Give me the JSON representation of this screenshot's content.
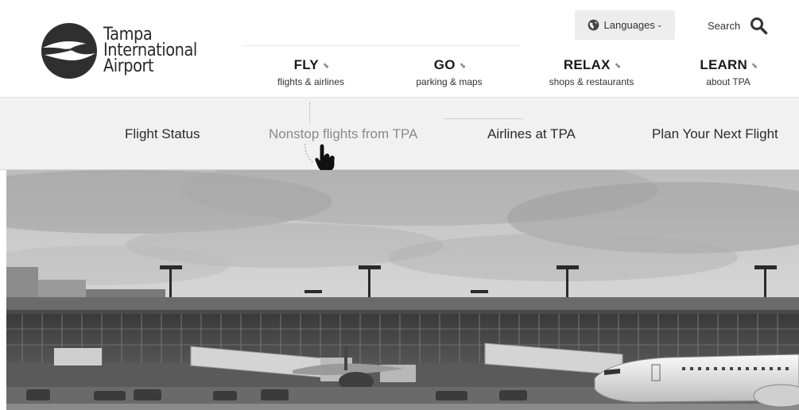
{
  "brand": {
    "logo_lines": [
      "Tampa",
      "International",
      "Airport"
    ]
  },
  "header": {
    "languages_label": "Languages",
    "search_label": "Search"
  },
  "nav": [
    {
      "label": "FLY",
      "sub": "flights & airlines"
    },
    {
      "label": "GO",
      "sub": "parking & maps"
    },
    {
      "label": "RELAX",
      "sub": "shops & restaurants"
    },
    {
      "label": "LEARN",
      "sub": "about TPA"
    }
  ],
  "subnav": [
    {
      "label": "Flight Status",
      "state": "normal"
    },
    {
      "label": "Nonstop flights from TPA",
      "state": "hovered"
    },
    {
      "label": "Airlines at TPA",
      "state": "normal"
    },
    {
      "label": "Plan Your Next Flight",
      "state": "normal"
    }
  ],
  "icons": {
    "languages": "globe-icon",
    "languages_caret": "chevron-down-icon",
    "search": "search-icon",
    "nav_arrow": "arrow-down-right-icon",
    "pointer": "hand-pointer-icon"
  },
  "colors": {
    "subnav_bg": "#f1f1f1",
    "lang_bg": "#ededed",
    "text": "#1a1a1a",
    "muted_text": "#8a8a8a"
  }
}
